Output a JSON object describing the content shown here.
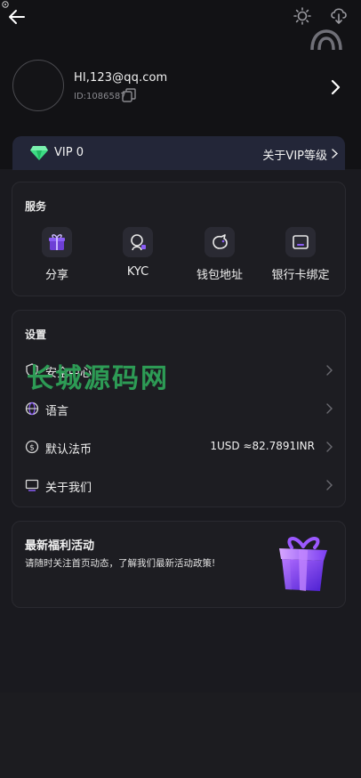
{
  "header": {
    "back_icon": "arrow-left-icon",
    "theme_icon": "sun-icon",
    "download_icon": "cloud-download-icon",
    "support_icon": "headset-icon"
  },
  "profile": {
    "email": "HI,123@qq.com",
    "id_label": "ID:1086587"
  },
  "vip": {
    "level": "VIP 0",
    "link": "关于VIP等级"
  },
  "services": {
    "title": "服务",
    "items": [
      {
        "label": "分享",
        "icon": "gift-box-icon"
      },
      {
        "label": "KYC",
        "icon": "user-verify-icon"
      },
      {
        "label": "钱包地址",
        "icon": "piggy-bank-icon"
      },
      {
        "label": "银行卡绑定",
        "icon": "bank-card-icon"
      }
    ]
  },
  "settings": {
    "title": "设置",
    "rows": [
      {
        "label": "安全中心",
        "icon": "shield-icon",
        "value": ""
      },
      {
        "label": "语言",
        "icon": "globe-icon",
        "value": ""
      },
      {
        "label": "默认法币",
        "icon": "dollar-coin-icon",
        "value": "1USD ≈82.7891INR"
      },
      {
        "label": "关于我们",
        "icon": "monitor-icon",
        "value": ""
      }
    ]
  },
  "watermark": "长城源码网",
  "promo": {
    "title": "最新福利活动",
    "subtitle": "请随时关注首页动态，了解我们最新活动政策!"
  },
  "colors": {
    "accent": "#8a5cf6",
    "gem": "#3ddc84",
    "watermark": "#2d9b55",
    "background": "#19191d",
    "card": "#1d1d22"
  }
}
